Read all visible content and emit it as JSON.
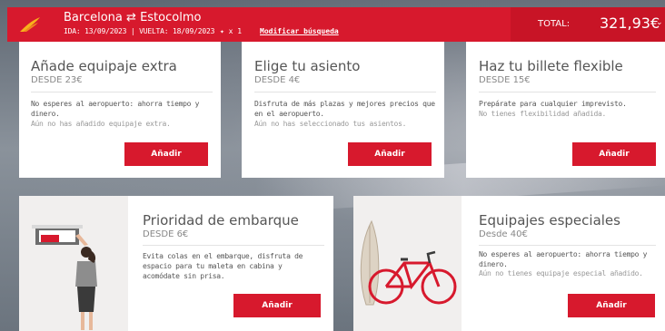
{
  "header": {
    "origin": "Barcelona",
    "swap_icon": "swap-arrows-icon",
    "destination": "Estocolmo",
    "dates": "IDA: 13/09/2023 | VUELTA: 18/09/2023",
    "passengers": "x 1",
    "modify_link": "Modificar búsqueda",
    "total_label": "TOTAL:",
    "total_value": "321,93€",
    "colors": {
      "brand_red": "#d7192d",
      "brand_dark_red": "#c81426"
    }
  },
  "cards": [
    {
      "title": "Añade equipaje extra",
      "from": "DESDE 23€",
      "desc": "No esperes al aeropuerto: ahorra tiempo y dinero.",
      "note": "Aún no has añadido equipaje extra.",
      "button": "Añadir"
    },
    {
      "title": "Elige tu asiento",
      "from": "DESDE 4€",
      "desc": "Disfruta de más plazas y mejores precios que en el aeropuerto.",
      "note": "Aún no has seleccionado tus asientos.",
      "button": "Añadir"
    },
    {
      "title": "Haz tu billete flexible",
      "from": "DESDE 15€",
      "desc": "Prepárate para cualquier imprevisto.",
      "note": "No tienes flexibilidad añadida.",
      "button": "Añadir"
    },
    {
      "title": "Prioridad de embarque",
      "from": "DESDE 6€",
      "desc": "Evita colas en el embarque, disfruta de espacio para tu maleta en cabina y acomódate sin prisa.",
      "note": "",
      "button": "Añadir",
      "illustration": "overhead-bin-person-illustration"
    },
    {
      "title": "Equipajes especiales",
      "from": "Desde 40€",
      "desc": "No esperes al aeropuerto: ahorra tiempo y dinero.",
      "note": "Aún no tienes equipaje especial añadido.",
      "button": "Añadir",
      "illustration": "surfboard-bicycle-illustration"
    }
  ]
}
